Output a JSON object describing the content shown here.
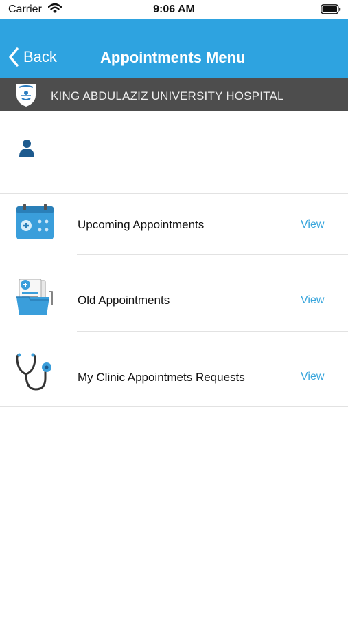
{
  "status_bar": {
    "carrier": "Carrier",
    "time": "9:06 AM"
  },
  "nav": {
    "back_label": "Back",
    "title": "Appointments Menu"
  },
  "banner": {
    "hospital_name": "KING ABDULAZIZ UNIVERSITY HOSPITAL"
  },
  "menu": {
    "items": [
      {
        "label": "Upcoming Appointments",
        "action": "View",
        "icon": "calendar-icon"
      },
      {
        "label": "Old Appointments",
        "action": "View",
        "icon": "medical-folder-icon"
      },
      {
        "label": "My Clinic Appointmets Requests",
        "action": "View",
        "icon": "stethoscope-icon"
      }
    ]
  },
  "colors": {
    "nav_blue": "#2ea3e0",
    "banner_gray": "#4d4d4d",
    "link_blue": "#3aa6dc",
    "icon_navy": "#1d5a8e"
  }
}
